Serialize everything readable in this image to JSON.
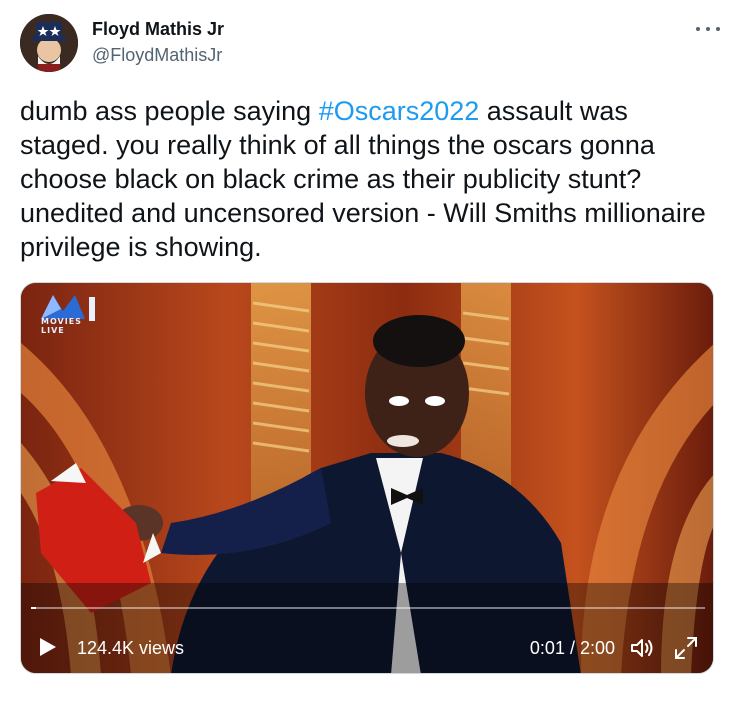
{
  "tweet": {
    "author": {
      "display_name": "Floyd Mathis Jr",
      "handle": "@FloydMathisJr",
      "avatar_icon": "uncle-sam-avatar"
    },
    "more_icon": "ellipsis-icon",
    "text_parts": {
      "before": "dumb ass people saying ",
      "hashtag": "#Oscars2022",
      "after": " assault was staged. you really think of all things the oscars gonna choose black on black crime as their publicity stunt? unedited and uncensored version - Will Smiths millionaire privilege is showing."
    },
    "video": {
      "logo_icon": "movies-live-logo",
      "logo_text": "MOVIES LIVE",
      "views": "124.4K views",
      "time": "0:01 / 2:00",
      "progress_fraction": 0.008,
      "icons": {
        "play": "play-icon",
        "volume": "volume-icon",
        "fullscreen": "fullscreen-icon"
      }
    }
  },
  "colors": {
    "accent": "#1d9bf0",
    "text": "#0f1419",
    "secondary": "#536471"
  }
}
